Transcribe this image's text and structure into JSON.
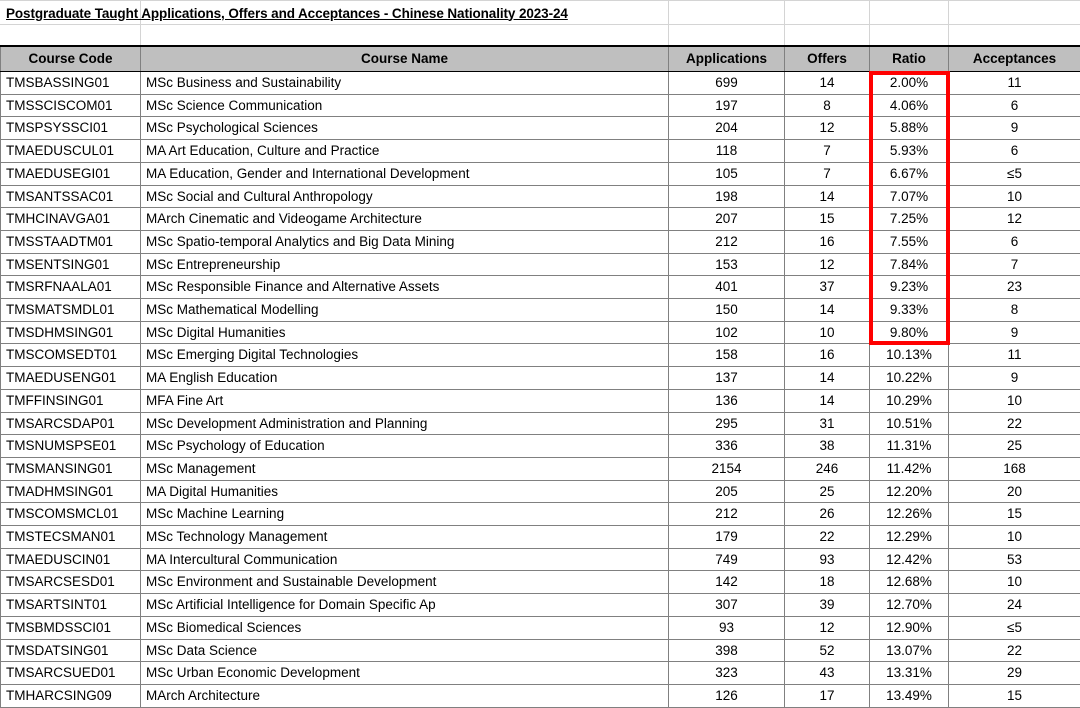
{
  "document": {
    "title": "Postgraduate Taught Applications, Offers and Acceptances - Chinese Nationality 2023-24"
  },
  "table": {
    "columns": [
      "Course Code",
      "Course Name",
      "Applications",
      "Offers",
      "Ratio",
      "Acceptances"
    ],
    "rows": [
      [
        "TMSBASSING01",
        "MSc Business and Sustainability",
        "699",
        "14",
        "2.00%",
        "11"
      ],
      [
        "TMSSCISCOM01",
        "MSc Science Communication",
        "197",
        "8",
        "4.06%",
        "6"
      ],
      [
        "TMSPSYSSCI01",
        "MSc Psychological Sciences",
        "204",
        "12",
        "5.88%",
        "9"
      ],
      [
        "TMAEDUSCUL01",
        "MA Art Education, Culture and Practice",
        "118",
        "7",
        "5.93%",
        "6"
      ],
      [
        "TMAEDUSEGI01",
        "MA Education, Gender and International Development",
        "105",
        "7",
        "6.67%",
        "≤5"
      ],
      [
        "TMSANTSSAC01",
        "MSc Social and Cultural Anthropology",
        "198",
        "14",
        "7.07%",
        "10"
      ],
      [
        "TMHCINAVGA01",
        "MArch Cinematic and Videogame Architecture",
        "207",
        "15",
        "7.25%",
        "12"
      ],
      [
        "TMSSTAADTM01",
        "MSc Spatio-temporal Analytics and Big Data Mining",
        "212",
        "16",
        "7.55%",
        "6"
      ],
      [
        "TMSENTSING01",
        "MSc Entrepreneurship",
        "153",
        "12",
        "7.84%",
        "7"
      ],
      [
        "TMSRFNAALA01",
        "MSc Responsible Finance and Alternative Assets",
        "401",
        "37",
        "9.23%",
        "23"
      ],
      [
        "TMSMATSMDL01",
        "MSc Mathematical Modelling",
        "150",
        "14",
        "9.33%",
        "8"
      ],
      [
        "TMSDHMSING01",
        "MSc Digital Humanities",
        "102",
        "10",
        "9.80%",
        "9"
      ],
      [
        "TMSCOMSEDT01",
        "MSc Emerging Digital Technologies",
        "158",
        "16",
        "10.13%",
        "11"
      ],
      [
        "TMAEDUSENG01",
        "MA English Education",
        "137",
        "14",
        "10.22%",
        "9"
      ],
      [
        "TMFFINSING01",
        "MFA Fine Art",
        "136",
        "14",
        "10.29%",
        "10"
      ],
      [
        "TMSARCSDAP01",
        "MSc Development Administration and Planning",
        "295",
        "31",
        "10.51%",
        "22"
      ],
      [
        "TMSNUMSPSE01",
        "MSc Psychology of Education",
        "336",
        "38",
        "11.31%",
        "25"
      ],
      [
        "TMSMANSING01",
        "MSc Management",
        "2154",
        "246",
        "11.42%",
        "168"
      ],
      [
        "TMADHMSING01",
        "MA Digital Humanities",
        "205",
        "25",
        "12.20%",
        "20"
      ],
      [
        "TMSCOMSMCL01",
        "MSc Machine Learning",
        "212",
        "26",
        "12.26%",
        "15"
      ],
      [
        "TMSTECSMAN01",
        "MSc Technology Management",
        "179",
        "22",
        "12.29%",
        "10"
      ],
      [
        "TMAEDUSCIN01",
        "MA Intercultural Communication",
        "749",
        "93",
        "12.42%",
        "53"
      ],
      [
        "TMSARCSESD01",
        "MSc Environment and Sustainable Development",
        "142",
        "18",
        "12.68%",
        "10"
      ],
      [
        "TMSARTSINT01",
        "MSc Artificial Intelligence for Domain Specific Ap",
        "307",
        "39",
        "12.70%",
        "24"
      ],
      [
        "TMSBMDSSCI01",
        "MSc Biomedical Sciences",
        "93",
        "12",
        "12.90%",
        "≤5"
      ],
      [
        "TMSDATSING01",
        "MSc Data Science",
        "398",
        "52",
        "13.07%",
        "22"
      ],
      [
        "TMSARCSUED01",
        "MSc Urban Economic Development",
        "323",
        "43",
        "13.31%",
        "29"
      ],
      [
        "TMHARCSING09",
        "MArch Architecture",
        "126",
        "17",
        "13.49%",
        "15"
      ]
    ]
  },
  "annotation": {
    "highlight_color": "#ff0000",
    "highlight_column": "Ratio",
    "highlight_first_row": "TMSBASSING01",
    "highlight_last_row": "TMSDHMSING01"
  },
  "colors": {
    "header_fill": "#bfbfbf",
    "border": "#808080",
    "gridline": "#d4d4d4",
    "text": "#000000"
  }
}
